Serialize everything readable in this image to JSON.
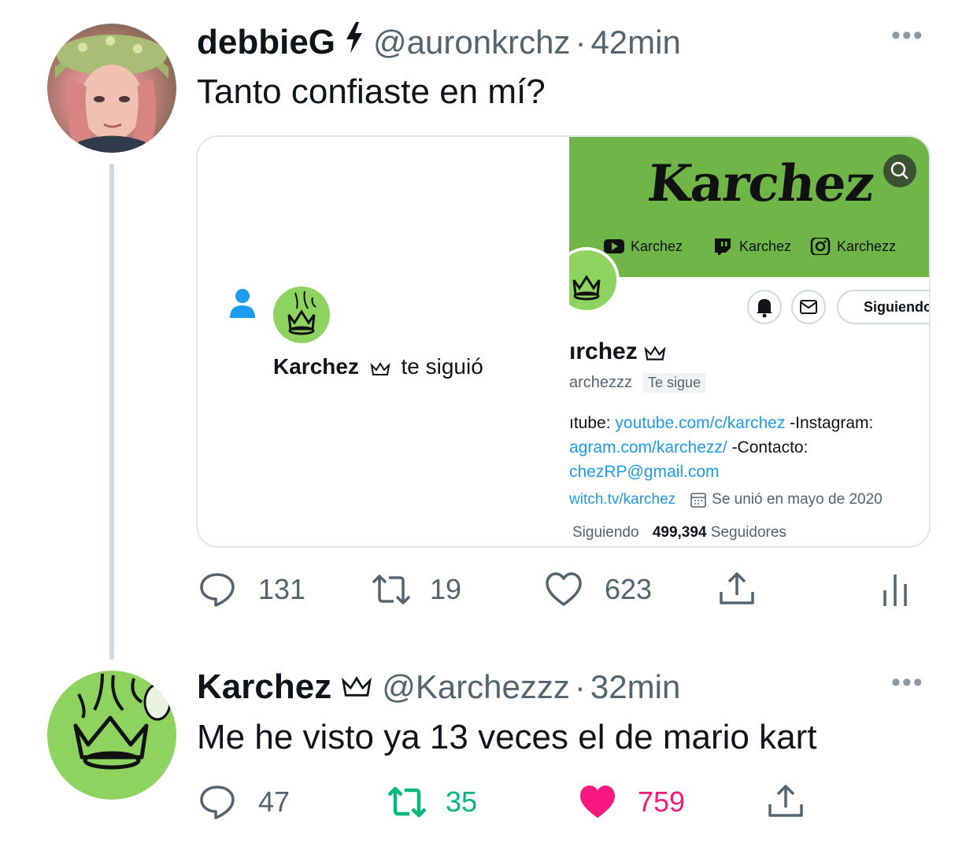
{
  "tweet1": {
    "display_name": "debbieG",
    "handle": "@auronkrchz",
    "separator": "·",
    "time": "42min",
    "text": "Tanto confiaste en mí?",
    "more_icon": "more-dots-icon",
    "stats": {
      "replies": "131",
      "retweets": "19",
      "likes": "623"
    }
  },
  "media": {
    "notification": {
      "name": "Karchez",
      "action": "te siguió"
    },
    "profile": {
      "banner_title": "Karchez",
      "banner_links": [
        "Karchez",
        "Karchez",
        "Karchezz"
      ],
      "follow_button": "Siguiendo",
      "name_partial": "ırchez",
      "handle_partial": "archezzz",
      "follows_you": "Te sigue",
      "bio_line1_prefix": "ıtube: ",
      "bio_line1_link": "youtube.com/c/karchez",
      "bio_line1_suffix": " -Instagram:",
      "bio_line2_link": "agram.com/karchezz/",
      "bio_line2_suffix": " -Contacto:",
      "bio_line3_link": "chezRP@gmail.com",
      "website": "witch.tv/karchez",
      "joined": "Se unió en mayo de 2020",
      "following_label": "Siguiendo",
      "followers_count": "499,394",
      "followers_label": "Seguidores"
    }
  },
  "tweet2": {
    "display_name": "Karchez",
    "handle": "@Karchezzz",
    "separator": "·",
    "time": "32min",
    "text": "Me he visto ya 13 veces el de mario kart",
    "stats": {
      "replies": "47",
      "retweets": "35",
      "likes": "759"
    }
  },
  "colors": {
    "accent_blue": "#1d9bf0",
    "retweet_green": "#00ba7c",
    "like_pink": "#f91880",
    "muted": "#536471",
    "banner_green": "#6fb548"
  }
}
